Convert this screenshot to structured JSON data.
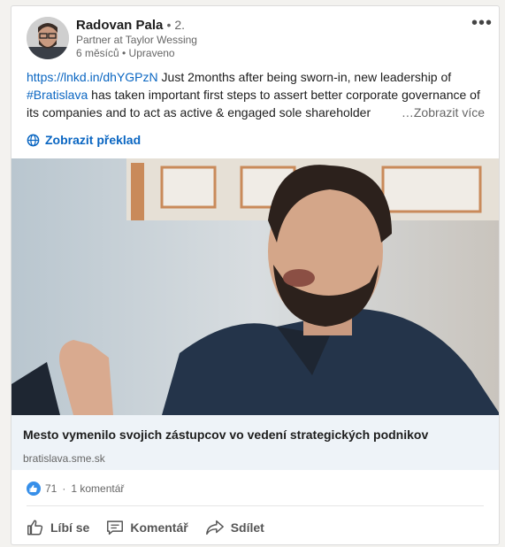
{
  "post": {
    "author": {
      "name": "Radovan Pala",
      "degree": "• 2.",
      "headline": "Partner at Taylor Wessing",
      "time": "6 měsíců • Upraveno"
    },
    "text": {
      "link": "https://lnkd.in/dhYGPzN",
      "part1": " Just 2months after being sworn-in, new leadership of ",
      "hashtag": "#Bratislava",
      "part2": " has taken important first steps to assert better corporate governance of its companies and to act as active & engaged sole shareholder",
      "see_more": "…Zobrazit více"
    },
    "translate_label": "Zobrazit překlad",
    "article": {
      "title": "Mesto vymenilo svojich zástupcov vo vedení strategických podnikov",
      "source": "bratislava.sme.sk"
    },
    "social": {
      "reactions": "71",
      "separator": "·",
      "comments": "1 komentář"
    },
    "actions": {
      "like": "Líbí se",
      "comment": "Komentář",
      "share": "Sdílet"
    },
    "colors": {
      "link": "#0a66c2",
      "like_badge": "#378fe9"
    }
  }
}
